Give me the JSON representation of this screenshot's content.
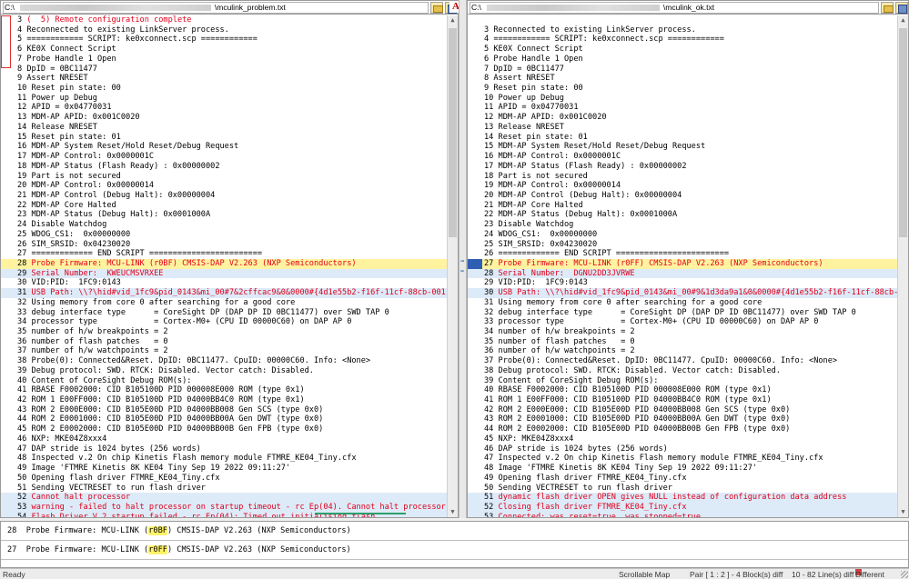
{
  "left": {
    "path": "C:\\",
    "path_tail": "\\mculink_problem.txt",
    "lines": [
      {
        "n": "3",
        "t": "(  5) Remote configuration complete",
        "c": "red"
      },
      {
        "n": "4",
        "t": "Reconnected to existing LinkServer process."
      },
      {
        "n": "5",
        "t": "============ SCRIPT: ke0xconnect.scp ============"
      },
      {
        "n": "6",
        "t": "KE0X Connect Script"
      },
      {
        "n": "7",
        "t": "Probe Handle 1 Open"
      },
      {
        "n": "8",
        "t": "DpID = 0BC11477"
      },
      {
        "n": "9",
        "t": "Assert NRESET"
      },
      {
        "n": "10",
        "t": "Reset pin state: 00"
      },
      {
        "n": "11",
        "t": "Power up Debug"
      },
      {
        "n": "12",
        "t": "APID = 0x04770031"
      },
      {
        "n": "13",
        "t": "MDM-AP APID: 0x001C0020"
      },
      {
        "n": "14",
        "t": "Release NRESET"
      },
      {
        "n": "15",
        "t": "Reset pin state: 01"
      },
      {
        "n": "16",
        "t": "MDM-AP System Reset/Hold Reset/Debug Request"
      },
      {
        "n": "17",
        "t": "MDM-AP Control: 0x0000001C"
      },
      {
        "n": "18",
        "t": "MDM-AP Status (Flash Ready) : 0x00000002"
      },
      {
        "n": "19",
        "t": "Part is not secured"
      },
      {
        "n": "20",
        "t": "MDM-AP Control: 0x00000014"
      },
      {
        "n": "21",
        "t": "MDM-AP Control (Debug Halt): 0x00000004"
      },
      {
        "n": "22",
        "t": "MDM-AP Core Halted"
      },
      {
        "n": "23",
        "t": "MDM-AP Status (Debug Halt): 0x0001000A"
      },
      {
        "n": "24",
        "t": "Disable Watchdog"
      },
      {
        "n": "25",
        "t": "WDOG_CS1:  0x00000000"
      },
      {
        "n": "26",
        "t": "SIM_SRSID: 0x04230020"
      },
      {
        "n": "27",
        "t": "============= END SCRIPT ========================"
      },
      {
        "n": "28",
        "t": "Probe Firmware: MCU-LINK (r0BF) CMSIS-DAP V2.263 (NXP Semiconductors)",
        "c": "red yel"
      },
      {
        "n": "29",
        "t": "Serial Number:  KWEUCMSVRXEE",
        "c": "red blu"
      },
      {
        "n": "30",
        "t": "VID:PID:  1FC9:0143"
      },
      {
        "n": "31",
        "t": "USB Path: \\\\?\\hid#vid_1fc9&pid_0143&mi_00#7&2cffcac9&0&0000#{4d1e55b2-f16f-11cf-88cb-001111000030}",
        "c": "red blu"
      },
      {
        "n": "32",
        "t": "Using memory from core 0 after searching for a good core"
      },
      {
        "n": "33",
        "t": "debug interface type      = CoreSight DP (DAP DP ID 0BC11477) over SWD TAP 0"
      },
      {
        "n": "34",
        "t": "processor type            = Cortex-M0+ (CPU ID 00000C60) on DAP AP 0"
      },
      {
        "n": "35",
        "t": "number of h/w breakpoints = 2"
      },
      {
        "n": "36",
        "t": "number of flash patches   = 0"
      },
      {
        "n": "37",
        "t": "number of h/w watchpoints = 2"
      },
      {
        "n": "38",
        "t": "Probe(0): Connected&Reset. DpID: 0BC11477. CpuID: 00000C60. Info: <None>"
      },
      {
        "n": "39",
        "t": "Debug protocol: SWD. RTCK: Disabled. Vector catch: Disabled."
      },
      {
        "n": "40",
        "t": "Content of CoreSight Debug ROM(s):"
      },
      {
        "n": "41",
        "t": "RBASE F0002000: CID B105100D PID 000008E000 ROM (type 0x1)"
      },
      {
        "n": "42",
        "t": "ROM 1 E00FF000: CID B105100D PID 04000BB4C0 ROM (type 0x1)"
      },
      {
        "n": "43",
        "t": "ROM 2 E000E000: CID B105E00D PID 04000BB008 Gen SCS (type 0x0)"
      },
      {
        "n": "44",
        "t": "ROM 2 E0001000: CID B105E00D PID 04000BB00A Gen DWT (type 0x0)"
      },
      {
        "n": "45",
        "t": "ROM 2 E0002000: CID B105E00D PID 04000BB00B Gen FPB (type 0x0)"
      },
      {
        "n": "46",
        "t": "NXP: MKE04Z8xxx4"
      },
      {
        "n": "47",
        "t": "DAP stride is 1024 bytes (256 words)"
      },
      {
        "n": "48",
        "t": "Inspected v.2 On chip Kinetis Flash memory module FTMRE_KE04_Tiny.cfx"
      },
      {
        "n": "49",
        "t": "Image 'FTMRE Kinetis 8K KE04 Tiny Sep 19 2022 09:11:27'"
      },
      {
        "n": "50",
        "t": "Opening flash driver FTMRE_KE04_Tiny.cfx"
      },
      {
        "n": "51",
        "t": "Sending VECTRESET to run flash driver"
      },
      {
        "n": "52",
        "t": "Cannot halt processor",
        "c": "red blu"
      },
      {
        "n": "53",
        "t": "warning - failed to halt processor on startup timeout - rc Ep(04). Cannot halt processor.",
        "c": "red blu"
      },
      {
        "n": "54",
        "t": "Flash Driver V.2 startup failed - rc Ep(04): Timed out initialising flash",
        "c": "red blu"
      }
    ]
  },
  "right": {
    "path": "C:\\",
    "path_tail": "\\mculink_ok.txt",
    "lines": [
      {
        "n": "",
        "t": ""
      },
      {
        "n": "3",
        "t": "Reconnected to existing LinkServer process."
      },
      {
        "n": "4",
        "t": "============ SCRIPT: ke0xconnect.scp ============"
      },
      {
        "n": "5",
        "t": "KE0X Connect Script"
      },
      {
        "n": "6",
        "t": "Probe Handle 1 Open"
      },
      {
        "n": "7",
        "t": "DpID = 0BC11477"
      },
      {
        "n": "8",
        "t": "Assert NRESET"
      },
      {
        "n": "9",
        "t": "Reset pin state: 00"
      },
      {
        "n": "10",
        "t": "Power up Debug"
      },
      {
        "n": "11",
        "t": "APID = 0x04770031"
      },
      {
        "n": "12",
        "t": "MDM-AP APID: 0x001C0020"
      },
      {
        "n": "13",
        "t": "Release NRESET"
      },
      {
        "n": "14",
        "t": "Reset pin state: 01"
      },
      {
        "n": "15",
        "t": "MDM-AP System Reset/Hold Reset/Debug Request"
      },
      {
        "n": "16",
        "t": "MDM-AP Control: 0x0000001C"
      },
      {
        "n": "17",
        "t": "MDM-AP Status (Flash Ready) : 0x00000002"
      },
      {
        "n": "18",
        "t": "Part is not secured"
      },
      {
        "n": "19",
        "t": "MDM-AP Control: 0x00000014"
      },
      {
        "n": "20",
        "t": "MDM-AP Control (Debug Halt): 0x00000004"
      },
      {
        "n": "21",
        "t": "MDM-AP Core Halted"
      },
      {
        "n": "22",
        "t": "MDM-AP Status (Debug Halt): 0x0001000A"
      },
      {
        "n": "23",
        "t": "Disable Watchdog"
      },
      {
        "n": "24",
        "t": "WDOG_CS1:  0x00000000"
      },
      {
        "n": "25",
        "t": "SIM_SRSID: 0x04230020"
      },
      {
        "n": "26",
        "t": "============= END SCRIPT ========================"
      },
      {
        "n": "27",
        "t": "Probe Firmware: MCU-LINK (r0FF) CMSIS-DAP V2.263 (NXP Semiconductors)",
        "c": "red yel sel"
      },
      {
        "n": "28",
        "t": "Serial Number:  DGNU2DD3JVRWE",
        "c": "red blu"
      },
      {
        "n": "29",
        "t": "VID:PID:  1FC9:0143"
      },
      {
        "n": "30",
        "t": "USB Path: \\\\?\\hid#vid_1fc9&pid_0143&mi_00#9&1d3da9a1&0&0000#{4d1e55b2-f16f-11cf-88cb-001111000030}",
        "c": "red blu"
      },
      {
        "n": "31",
        "t": "Using memory from core 0 after searching for a good core"
      },
      {
        "n": "32",
        "t": "debug interface type      = CoreSight DP (DAP DP ID 0BC11477) over SWD TAP 0"
      },
      {
        "n": "33",
        "t": "processor type            = Cortex-M0+ (CPU ID 00000C60) on DAP AP 0"
      },
      {
        "n": "34",
        "t": "number of h/w breakpoints = 2"
      },
      {
        "n": "35",
        "t": "number of flash patches   = 0"
      },
      {
        "n": "36",
        "t": "number of h/w watchpoints = 2"
      },
      {
        "n": "37",
        "t": "Probe(0): Connected&Reset. DpID: 0BC11477. CpuID: 00000C60. Info: <None>"
      },
      {
        "n": "38",
        "t": "Debug protocol: SWD. RTCK: Disabled. Vector catch: Disabled."
      },
      {
        "n": "39",
        "t": "Content of CoreSight Debug ROM(s):"
      },
      {
        "n": "40",
        "t": "RBASE F0002000: CID B105100D PID 000008E000 ROM (type 0x1)"
      },
      {
        "n": "41",
        "t": "ROM 1 E00FF000: CID B105100D PID 04000BB4C0 ROM (type 0x1)"
      },
      {
        "n": "42",
        "t": "ROM 2 E000E000: CID B105E00D PID 04000BB008 Gen SCS (type 0x0)"
      },
      {
        "n": "43",
        "t": "ROM 2 E0001000: CID B105E00D PID 04000BB00A Gen DWT (type 0x0)"
      },
      {
        "n": "44",
        "t": "ROM 2 E0002000: CID B105E00D PID 04000BB00B Gen FPB (type 0x0)"
      },
      {
        "n": "45",
        "t": "NXP: MKE04Z8xxx4"
      },
      {
        "n": "46",
        "t": "DAP stride is 1024 bytes (256 words)"
      },
      {
        "n": "47",
        "t": "Inspected v.2 On chip Kinetis Flash memory module FTMRE_KE04_Tiny.cfx"
      },
      {
        "n": "48",
        "t": "Image 'FTMRE Kinetis 8K KE04 Tiny Sep 19 2022 09:11:27'"
      },
      {
        "n": "49",
        "t": "Opening flash driver FTMRE_KE04_Tiny.cfx"
      },
      {
        "n": "50",
        "t": "Sending VECTRESET to run flash driver"
      },
      {
        "n": "51",
        "t": "dynamic flash driver OPEN gives NULL instead of configuration data address",
        "c": "red blu"
      },
      {
        "n": "52",
        "t": "Closing flash driver FTMRE_KE04_Tiny.cfx",
        "c": "red blu"
      },
      {
        "n": "53",
        "t": "Connected: was_reset=true. was_stopped=true",
        "c": "red blu"
      }
    ]
  },
  "compare": {
    "top": {
      "n": "28",
      "pre": "  Probe Firmware: MCU-LINK (",
      "hl": "r0BF",
      "post": ") CMSIS-DAP V2.263 (NXP Semiconductors)"
    },
    "bottom": {
      "n": "27",
      "pre": "  Probe Firmware: MCU-LINK (",
      "hl": "r0FF",
      "post": ") CMSIS-DAP V2.263 (NXP Semiconductors)"
    }
  },
  "status": {
    "left": "Ready",
    "map": "Scrollable Map",
    "pair": "Pair [ 1 : 2 ] - 4 Block(s) diff",
    "lines": "10 - 82 Line(s) diff",
    "diff": "Different"
  }
}
